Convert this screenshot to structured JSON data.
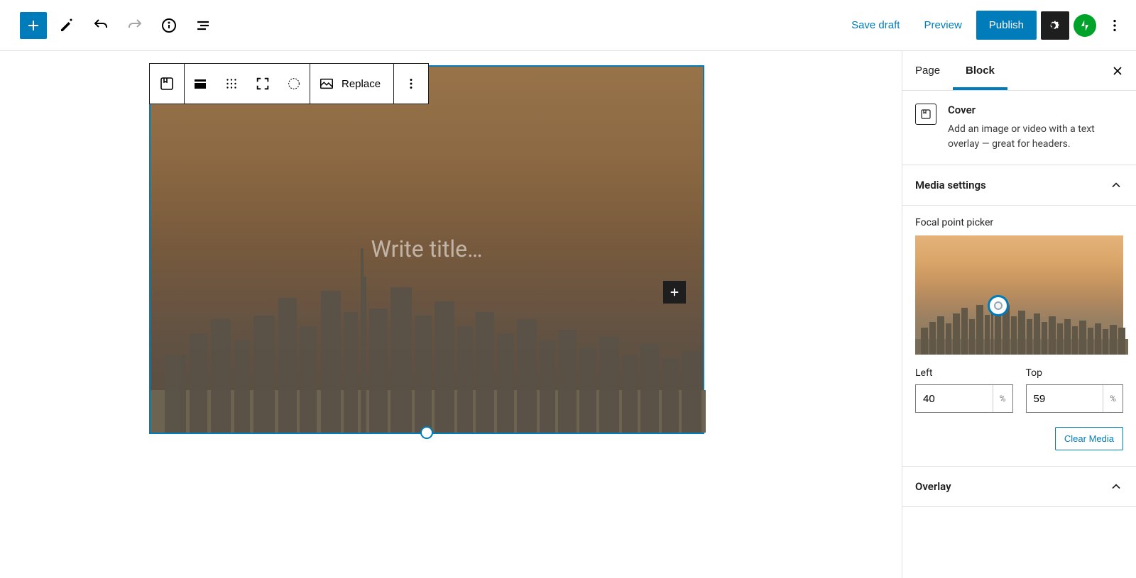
{
  "topbar": {
    "save_draft": "Save draft",
    "preview": "Preview",
    "publish": "Publish"
  },
  "block_toolbar": {
    "replace": "Replace"
  },
  "cover": {
    "title_placeholder": "Write title…"
  },
  "sidebar": {
    "tabs": {
      "page": "Page",
      "block": "Block"
    },
    "block_info": {
      "title": "Cover",
      "description": "Add an image or video with a text overlay — great for headers."
    },
    "panels": {
      "media_settings": "Media settings",
      "overlay": "Overlay"
    },
    "focal": {
      "label": "Focal point picker",
      "left_label": "Left",
      "top_label": "Top",
      "left_value": "40",
      "top_value": "59",
      "unit": "%"
    },
    "clear_media": "Clear Media"
  }
}
